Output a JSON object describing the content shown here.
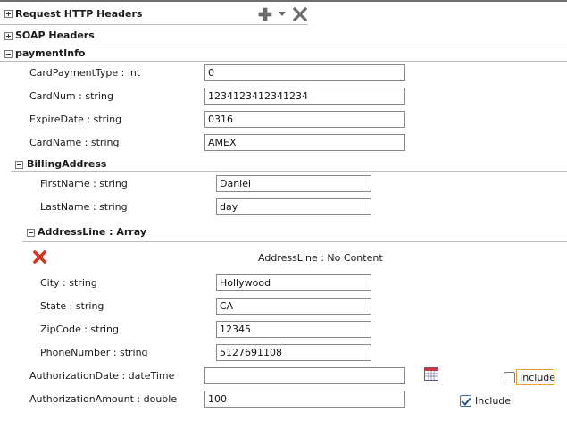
{
  "sections": {
    "request_headers": "Request HTTP Headers",
    "soap_headers": "SOAP Headers",
    "payment_info": "paymentInfo",
    "billing_address": "BillingAddress",
    "address_line": "AddressLine : Array"
  },
  "toolbar": {
    "add_icon": "plus-icon",
    "dropdown_icon": "chevron-down-icon",
    "delete_icon": "x-icon"
  },
  "payment_fields": [
    {
      "label": "CardPaymentType : int",
      "value": "0"
    },
    {
      "label": "CardNum : string",
      "value": "1234123412341234"
    },
    {
      "label": "ExpireDate : string",
      "value": "0316"
    },
    {
      "label": "CardName : string",
      "value": "AMEX"
    }
  ],
  "billing_fields": [
    {
      "label": "FirstName : string",
      "value": "Daniel"
    },
    {
      "label": "LastName : string",
      "value": "day"
    }
  ],
  "address_line_status": "AddressLine : No Content",
  "address_fields": [
    {
      "label": "City : string",
      "value": "Hollywood"
    },
    {
      "label": "State : string",
      "value": "CA"
    },
    {
      "label": "ZipCode : string",
      "value": "12345"
    },
    {
      "label": "PhoneNumber : string",
      "value": "5127691108"
    }
  ],
  "authorization": {
    "date_label": "AuthorizationDate : dateTime",
    "date_value": "",
    "date_include_label": "Include",
    "date_include_checked": false,
    "amount_label": "AuthorizationAmount : double",
    "amount_value": "100",
    "amount_include_label": "Include",
    "amount_include_checked": true
  },
  "colors": {
    "delete_red": "#d8341c",
    "toolbar_gray": "#6e6e6e",
    "focus_orange": "#e8a33a"
  }
}
